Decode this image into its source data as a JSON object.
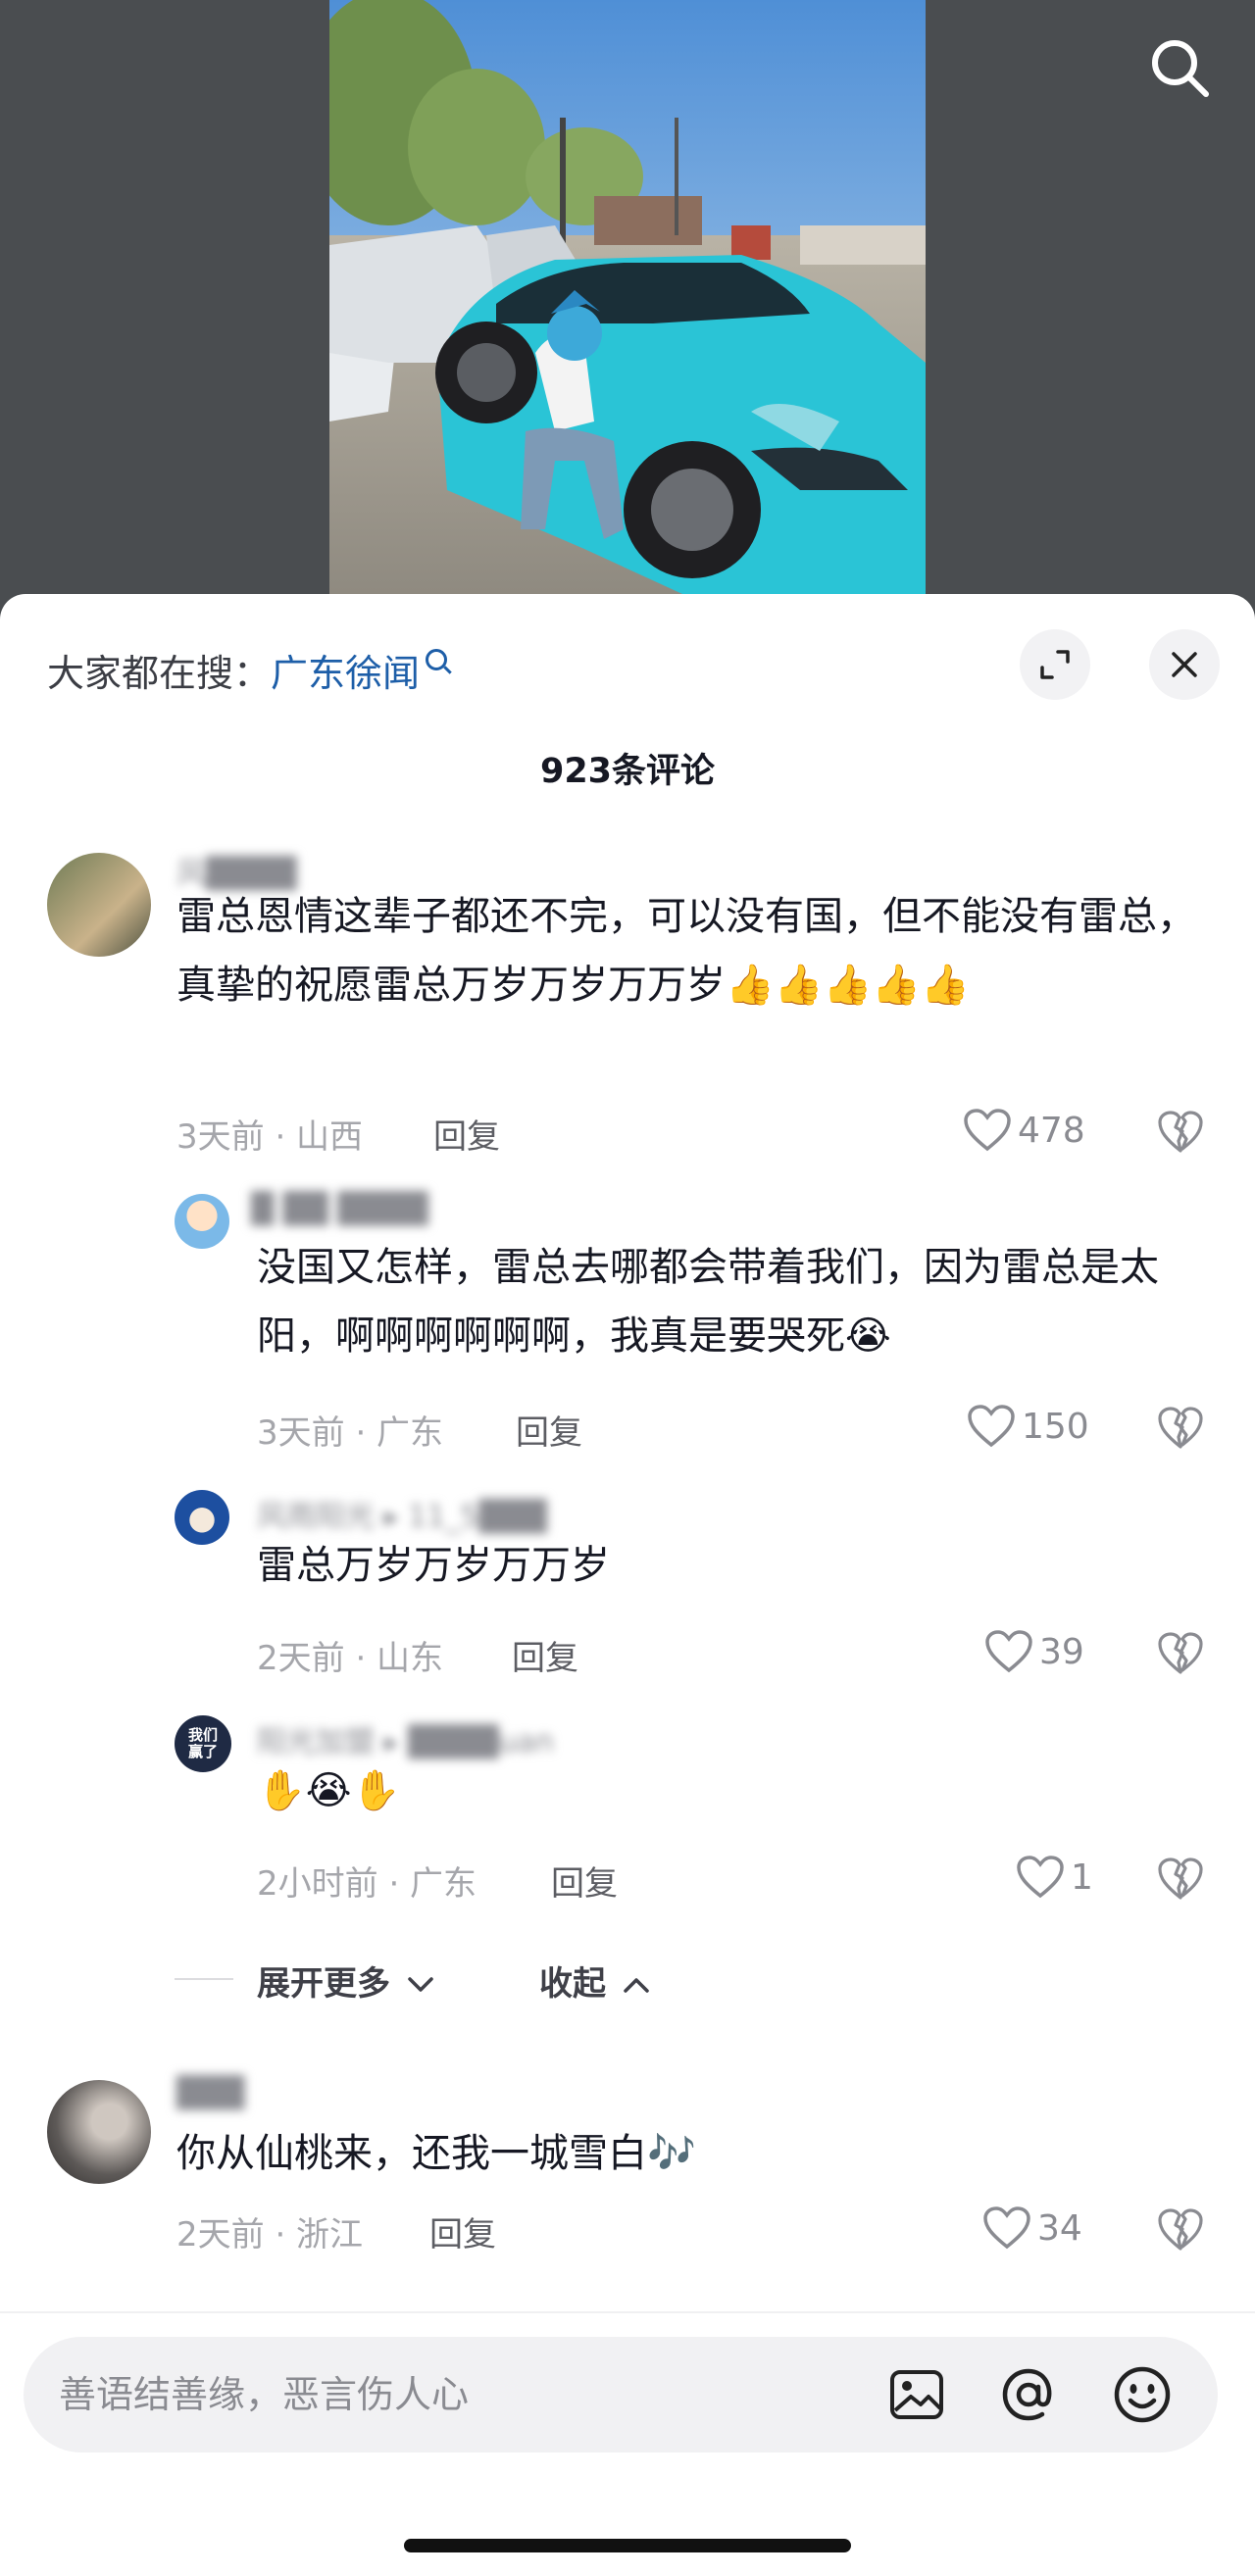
{
  "search_hint": {
    "prefix": "大家都在搜：",
    "keyword": "广东徐闻"
  },
  "comment_count": "923条评论",
  "comments": [
    {
      "author": "风████",
      "text": "雷总恩情这辈子都还不完，可以没有国，但不能没有雷总，真挚的祝愿雷总万岁万岁万万岁👍👍👍👍👍",
      "meta": "3天前 · 山西",
      "reply_label": "回复",
      "likes": "478",
      "replies": [
        {
          "author": "█ ██ ████",
          "text": "没国又怎样，雷总去哪都会带着我们，因为雷总是太阳，啊啊啊啊啊啊，我真是要哭死😭",
          "meta": "3天前 · 广东",
          "reply_label": "回复",
          "likes": "150"
        },
        {
          "author": "风雨阳光 ▸ 11_5███",
          "text": "雷总万岁万岁万万岁",
          "meta": "2天前 · 山东",
          "reply_label": "回复",
          "likes": "39"
        },
        {
          "author": "阳光加盟 ▸ ████uan",
          "text": "✋😭✋",
          "meta": "2小时前 · 广东",
          "reply_label": "回复",
          "likes": "1",
          "avatar_text": "我们赢了"
        }
      ],
      "expand_more": "展开更多",
      "collapse": "收起"
    },
    {
      "author": "███",
      "text": "你从仙桃来，还我一城雪白🎶",
      "meta": "2天前 · 浙江",
      "reply_label": "回复",
      "likes": "34"
    }
  ],
  "input": {
    "placeholder": "善语结善缘，恶言伤人心"
  },
  "icons": {
    "search": "search-icon",
    "expand": "expand-icon",
    "close": "close-icon",
    "like": "heart-icon",
    "dislike": "broken-heart-icon",
    "image": "image-icon",
    "mention": "at-icon",
    "emoji": "emoji-icon"
  },
  "colors": {
    "keyword": "#1d5ea8",
    "car": "#2ac4d6"
  }
}
